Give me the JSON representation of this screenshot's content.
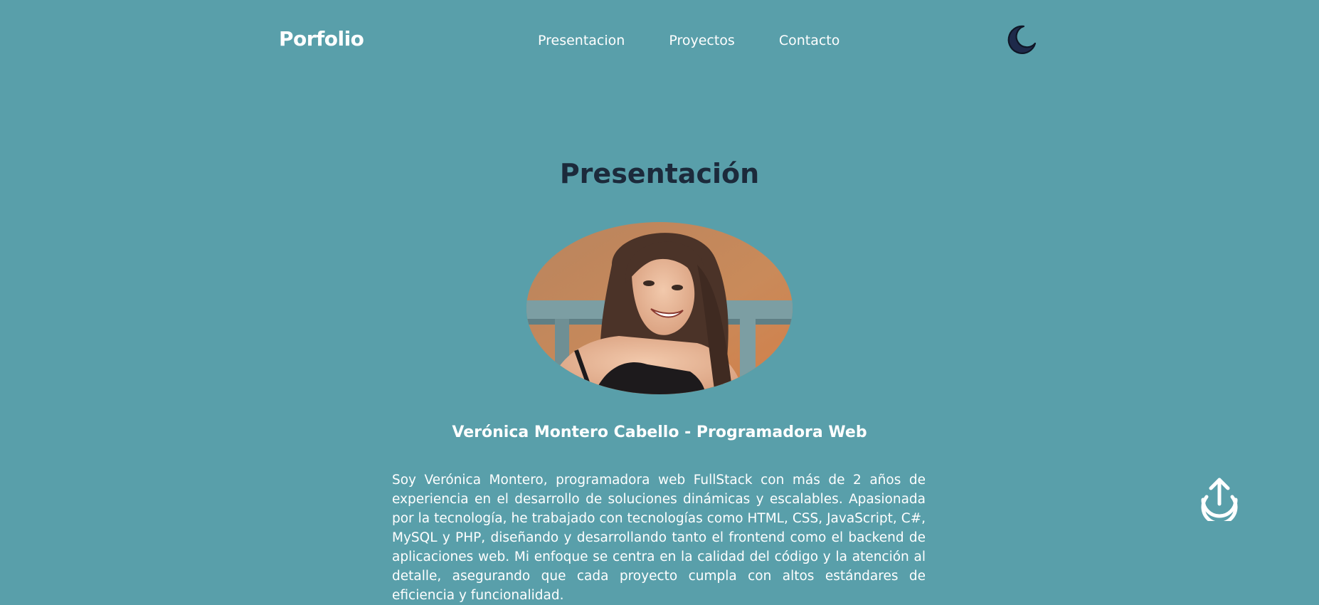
{
  "header": {
    "brand": "Porfolio",
    "nav": [
      {
        "label": "Presentacion"
      },
      {
        "label": "Proyectos"
      },
      {
        "label": "Contacto"
      }
    ],
    "theme_toggle_icon": "moon-icon"
  },
  "main": {
    "section_title": "Presentación",
    "profile_photo": "profile-photo",
    "subtitle": "Verónica Montero Cabello - Programadora Web",
    "bio": "Soy Verónica Montero, programadora web FullStack con más de 2 años de experiencia en el desarrollo de soluciones dinámicas y escalables. Apasionada por la tecnología, he trabajado con tecnologías como HTML, CSS, JavaScript, C#, MySQL y PHP, diseñando y desarrollando tanto el frontend como el backend de aplicaciones web. Mi enfoque se centra en la calidad del código y la atención al detalle, asegurando que cada proyecto cumpla con altos estándares de eficiencia y funcionalidad."
  },
  "scroll_top_icon": "arrow-up-circle-icon",
  "colors": {
    "background": "#599faa",
    "title": "#1c2a3b",
    "text": "#ffffff",
    "moon": "#1e2a4a"
  }
}
